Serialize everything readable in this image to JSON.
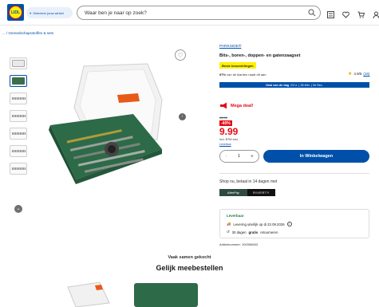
{
  "header": {
    "logo_text": "LIDL",
    "store_label": "Selecteer jouw winkel",
    "search_placeholder": "Waar ben je naar op zoek?"
  },
  "breadcrumb": "... / Gereedschapsstoffen & sets",
  "product": {
    "brand": "PARKSIDE®",
    "title": "Bits-, boren-, doppen- en gatenzaagset",
    "badge": "Beste beoordelingen",
    "recommend_pct": "97%",
    "recommend_text": "van de klanten raadt dit aan",
    "rating": "4.9/5",
    "rating_count": "(16)",
    "deal_label": "Deal van de dag",
    "deal_timer": "23 U. | 35 Min. | 34 Sec.",
    "mega_deal": "Mega deal!",
    "old_price": "16.99",
    "discount": "-40%",
    "price": "9.99",
    "vat": "Incl. BTW excl.",
    "delivery_costs": "Leverkos",
    "quantity": "1",
    "cart_label": "In Winkelwagen"
  },
  "payment": {
    "label": "Shop nu, betaal in 14 dagen met",
    "option1": "AfterPay",
    "option2": "RIVERTY"
  },
  "delivery": {
    "status": "Leverbaar",
    "line1": "Levering uiterlijk op di 22.09.2026",
    "line2_prefix": "30 dagen",
    "line2_bold": "gratis",
    "line2_suffix": "retourneren"
  },
  "article_number": "Artikelnummer: 100396653",
  "recommend_section": {
    "subtitle": "Vaak samen gekocht",
    "title": "Gelijk meebestellen"
  },
  "colors": {
    "brand_blue": "#0050aa",
    "price_red": "#e60a14",
    "badge_yellow": "#fff000",
    "case_green": "#2d6a48"
  }
}
